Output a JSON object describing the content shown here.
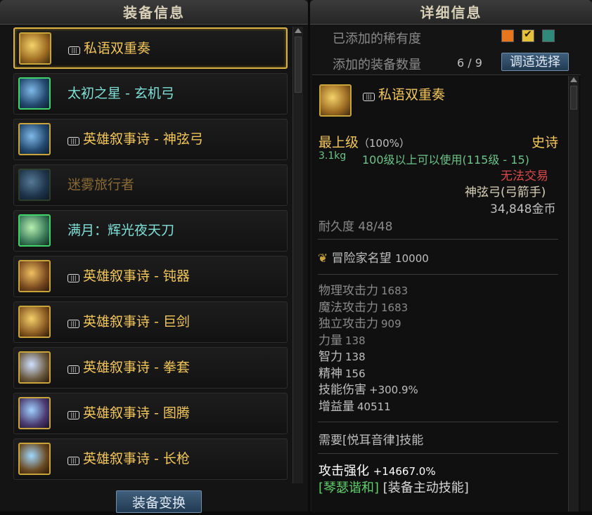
{
  "left_panel": {
    "title": "装备信息",
    "items": [
      {
        "name": "私语双重奏",
        "color": "gold",
        "tag": true,
        "selected": true,
        "icon": "harp-icon"
      },
      {
        "name": "太初之星 - 玄机弓",
        "color": "cyan",
        "tag": false,
        "icon": "bow-icon"
      },
      {
        "name": "英雄叙事诗 - 神弦弓",
        "color": "gold",
        "tag": true,
        "icon": "bow-icon"
      },
      {
        "name": "迷雾旅行者",
        "color": "dim",
        "tag": false,
        "icon": "bow-icon"
      },
      {
        "name": "满月：辉光夜天刀",
        "color": "cyan",
        "tag": false,
        "icon": "blade-icon"
      },
      {
        "name": "英雄叙事诗 - 钝器",
        "color": "gold",
        "tag": true,
        "icon": "mace-icon"
      },
      {
        "name": "英雄叙事诗 - 巨剑",
        "color": "gold",
        "tag": true,
        "icon": "greatsword-icon"
      },
      {
        "name": "英雄叙事诗 - 拳套",
        "color": "gold",
        "tag": true,
        "icon": "gauntlet-icon"
      },
      {
        "name": "英雄叙事诗 - 图腾",
        "color": "gold",
        "tag": true,
        "icon": "totem-icon"
      },
      {
        "name": "英雄叙事诗 - 长枪",
        "color": "gold",
        "tag": true,
        "icon": "spear-icon"
      }
    ],
    "swap_button": "装备变换"
  },
  "right_panel": {
    "title": "详细信息",
    "rarity_label": "已添加的稀有度",
    "rarity_colors": [
      "#e8761c",
      "#e6c23a",
      "#2f8a7a"
    ],
    "count_label": "添加的装备数量",
    "count_value": "6 / 9",
    "adjust_button": "调适选择",
    "item_name": "私语双重奏",
    "grade": "最上级",
    "grade_pct": "（100%）",
    "rarity": "史诗",
    "weight": "3.1kg",
    "level_req": "100级以上可以使用(115级 - 15)",
    "trade": "无法交易",
    "weapon_type": "神弦弓(弓箭手)",
    "price": "34,848金币",
    "durability": "耐久度 48/48",
    "fame_label": "冒险家名望",
    "fame_value": "10000",
    "stats": [
      {
        "label": "物理攻击力",
        "value": "1683",
        "lit": false
      },
      {
        "label": "魔法攻击力",
        "value": "1683",
        "lit": false
      },
      {
        "label": "独立攻击力",
        "value": "909",
        "lit": false
      },
      {
        "label": "力量",
        "value": "138",
        "lit": false
      },
      {
        "label": "智力",
        "value": "138",
        "lit": true
      },
      {
        "label": "精神",
        "value": "156",
        "lit": true
      },
      {
        "label": "技能伤害",
        "value": "+300.9%",
        "lit": true
      },
      {
        "label": "增益量",
        "value": "40511",
        "lit": true
      }
    ],
    "require_skill": "需要[悦耳音律]技能",
    "attack_boost_label": "攻击强化",
    "attack_boost_value": "+14667.0%",
    "active_skill": "[琴瑟谐和]",
    "active_skill_suffix": "[装备主动技能]"
  }
}
